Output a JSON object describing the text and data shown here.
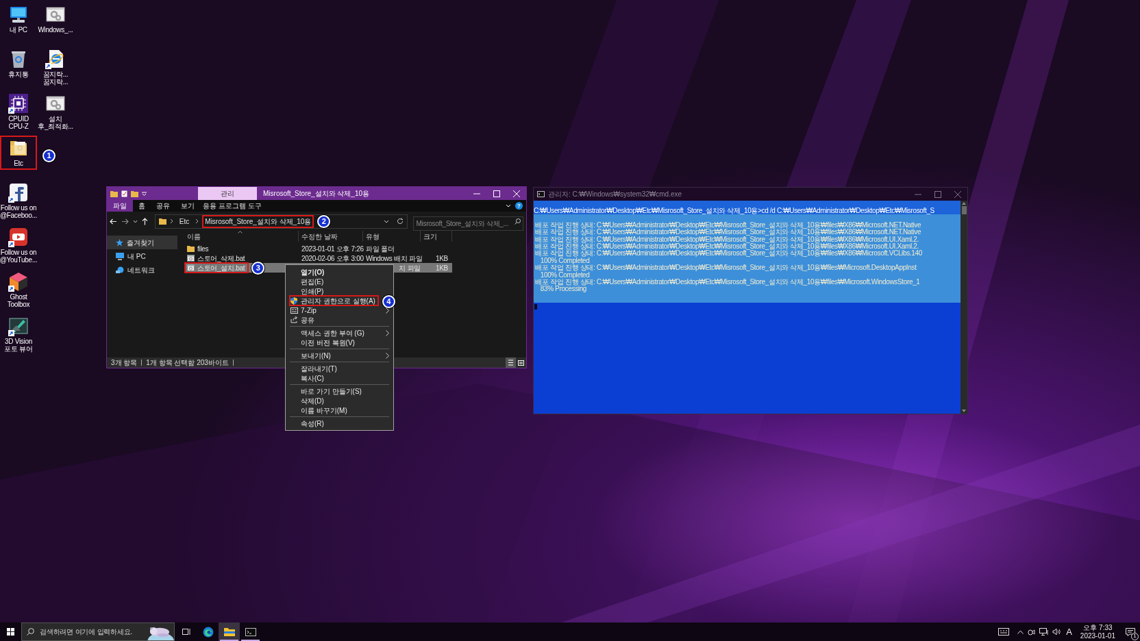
{
  "desktop_columns": [
    [
      {
        "kind": "pc",
        "label": "내 PC",
        "shortcut": false
      },
      {
        "kind": "recycle",
        "label": "휴지통",
        "shortcut": false
      },
      {
        "kind": "cpu",
        "label": "CPUID\nCPU-Z",
        "shortcut": true
      },
      {
        "kind": "folder",
        "label": "Etc",
        "shortcut": false,
        "callout": "1"
      },
      {
        "kind": "facebook",
        "label": "Follow us on\n@Faceboo...",
        "shortcut": true
      },
      {
        "kind": "youtube",
        "label": "Follow us on\n@YouTube...",
        "shortcut": true
      },
      {
        "kind": "ghost",
        "label": "Ghost\nToolbox",
        "shortcut": true
      },
      {
        "kind": "vision",
        "label": "3D Vision\n포토 뷰어",
        "shortcut": true
      }
    ],
    [
      {
        "kind": "settings_file",
        "label": "Windows_...",
        "shortcut": false
      },
      {
        "kind": "ie",
        "label": "꿈지락...\n꿈지락...",
        "shortcut": true
      },
      {
        "kind": "settings_file",
        "label": "설치\n후_최적화...",
        "shortcut": false
      }
    ]
  ],
  "explorer": {
    "context_tab": "관리",
    "title": "Misrosoft_Store_설치와 삭제_10용",
    "ribbon_tabs": [
      {
        "label": "파일",
        "kind": "file"
      },
      {
        "label": "홈",
        "kind": "tab"
      },
      {
        "label": "공유",
        "kind": "tab"
      },
      {
        "label": "보기",
        "kind": "tab"
      },
      {
        "label": "응용 프로그램 도구",
        "kind": "contextual"
      }
    ],
    "help": "?",
    "address": {
      "segments": [
        {
          "label": "Etc"
        },
        {
          "label": "Misrosoft_Store_설치와 삭제_10용",
          "callout": "2"
        }
      ]
    },
    "search": {
      "placeholder": "Misrosoft_Store_설치와 삭제_..."
    },
    "nav": [
      {
        "kind": "star",
        "label": "즐겨찾기",
        "selected": true
      },
      {
        "kind": "pc",
        "label": "내 PC",
        "selected": false
      },
      {
        "kind": "network",
        "label": "네트워크",
        "selected": false
      }
    ],
    "columns": [
      "이름",
      "수정한 날짜",
      "유형",
      "크기"
    ],
    "files": [
      {
        "kind": "folder",
        "name": "files",
        "date": "2023-01-01 오후 7:26",
        "type": "파일 폴더",
        "selected": false,
        "covered": false
      },
      {
        "kind": "batch",
        "name": "스토어_삭제.bat",
        "date": "2020-02-06 오후 3:00",
        "type": "Windows 배치 파일",
        "size": "1KB",
        "selected": false,
        "covered": false
      },
      {
        "kind": "batch",
        "name": "스토어_설치.bat",
        "type": "치 파일",
        "size": "1KB",
        "selected": true,
        "covered": true,
        "callout": "3"
      }
    ],
    "status": {
      "count": "3개 항목",
      "selection": "1개 항목 선택함 203바이트"
    }
  },
  "context_menu": [
    [
      {
        "label": "열기(O)",
        "default": true,
        "submenu": false
      },
      {
        "label": "편집(E)",
        "default": false,
        "submenu": false
      },
      {
        "label": "인쇄(P)",
        "default": false,
        "submenu": false
      },
      {
        "label": "관리자 권한으로 실행(A)",
        "default": false,
        "submenu": false,
        "kind": "shield",
        "callout": "4"
      },
      {
        "label": "7-Zip",
        "default": false,
        "submenu": true,
        "kind": "archive"
      },
      {
        "label": "공유",
        "default": false,
        "submenu": false,
        "kind": "share"
      }
    ],
    [
      {
        "label": "액세스 권한 부여 (G)",
        "default": false,
        "submenu": true
      },
      {
        "label": "이전 버전 복원(V)",
        "default": false,
        "submenu": false
      }
    ],
    [
      {
        "label": "보내기(N)",
        "default": false,
        "submenu": true
      }
    ],
    [
      {
        "label": "잘라내기(T)",
        "default": false,
        "submenu": false
      },
      {
        "label": "복사(C)",
        "default": false,
        "submenu": false
      }
    ],
    [
      {
        "label": "바로 가기 만들기(S)",
        "default": false,
        "submenu": false
      },
      {
        "label": "삭제(D)",
        "default": false,
        "submenu": false
      },
      {
        "label": "이름 바꾸기(M)",
        "default": false,
        "submenu": false
      }
    ],
    [
      {
        "label": "속성(R)",
        "default": false,
        "submenu": false
      }
    ]
  ],
  "cmd": {
    "title": "관리자: C:₩Windows₩system32₩cmd.exe",
    "prompt": "C:₩Users₩Administrator₩Desktop₩Etc₩Misrosoft_Store_설치와 삭제_10용>cd /d C:₩Users₩Administrator₩Desktop₩Etc₩Misrosoft_S",
    "lines": [
      " 배포 작업 진행 상태: C:₩Users₩Administrator₩Desktop₩Etc₩Misrosoft_Store_설치와 삭제_10용₩files₩X86₩Microsoft.NET.Native",
      " 배포 작업 진행 상태: C:₩Users₩Administrator₩Desktop₩Etc₩Misrosoft_Store_설치와 삭제_10용₩files₩X86₩Microsoft.NET.Native",
      " 배포 작업 진행 상태: C:₩Users₩Administrator₩Desktop₩Etc₩Misrosoft_Store_설치와 삭제_10용₩files₩X86₩Microsoft.UI.Xaml.2.",
      " 배포 작업 진행 상태: C:₩Users₩Administrator₩Desktop₩Etc₩Misrosoft_Store_설치와 삭제_10용₩files₩X86₩Microsoft.UI.Xaml.2.",
      " 배포 작업 진행 상태: C:₩Users₩Administrator₩Desktop₩Etc₩Misrosoft_Store_설치와 삭제_10용₩files₩X86₩Microsoft.VCLibs.140",
      "    100% Completed",
      " 배포 작업 진행 상태: C:₩Users₩Administrator₩Desktop₩Etc₩Misrosoft_Store_설치와 삭제_10용₩files₩Microsoft.DesktopAppInst",
      "    100% Completed",
      " 배포 작업 진행 상태: C:₩Users₩Administrator₩Desktop₩Etc₩Misrosoft_Store_설치와 삭제_10용₩files₩Microsoft.WindowsStore_1",
      "    83% Processing"
    ]
  },
  "taskbar": {
    "search_placeholder": "검색하려면 여기에 입력하세요.",
    "apps": [
      {
        "kind": "task_view",
        "running": false,
        "active": false
      },
      {
        "kind": "edge",
        "running": false,
        "active": false
      },
      {
        "kind": "explorer",
        "running": true,
        "active": true
      },
      {
        "kind": "cmd",
        "running": true,
        "active": false
      }
    ],
    "ime": "A",
    "time": "오후 7:33",
    "date": "2023-01-01",
    "notifications": "1"
  }
}
